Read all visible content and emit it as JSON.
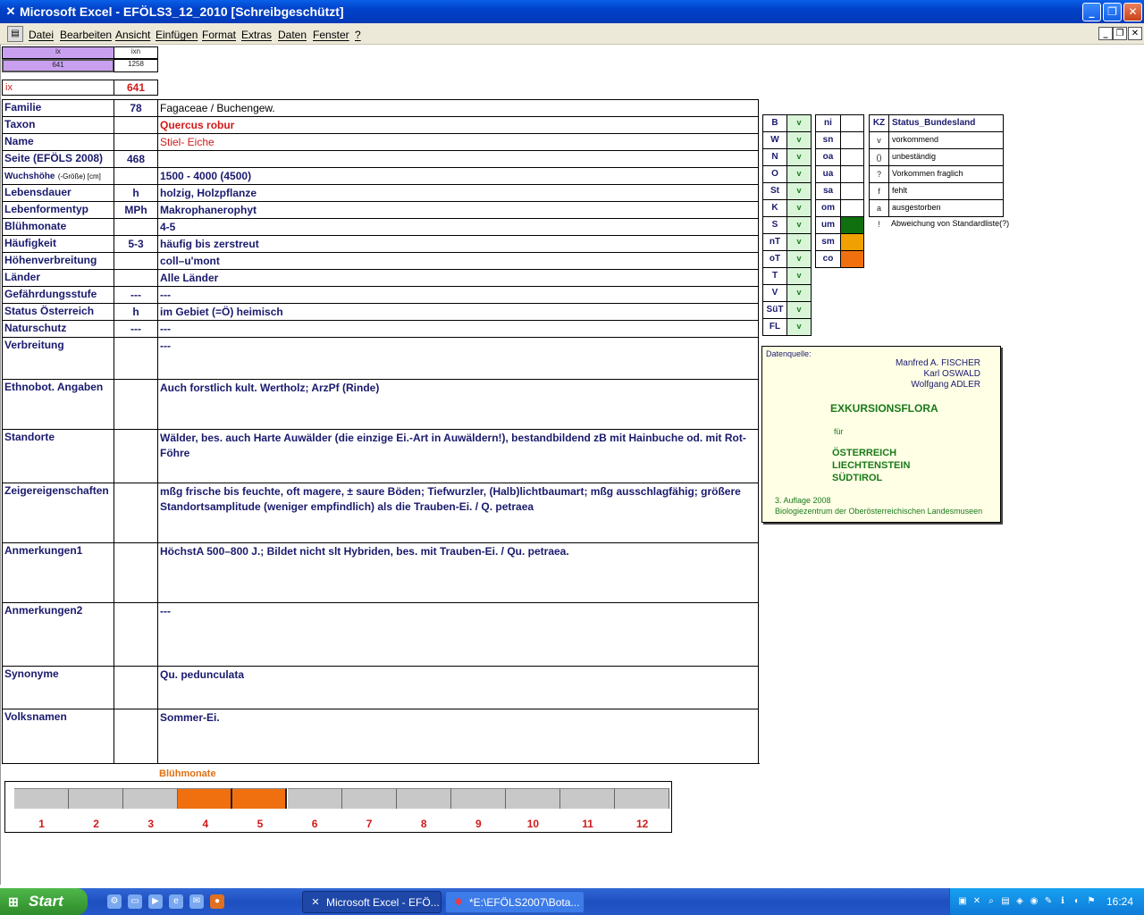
{
  "window": {
    "title": "Microsoft Excel - EFÖLS3_12_2010  [Schreibgeschützt]"
  },
  "menu": [
    "Datei",
    "Bearbeiten",
    "Ansicht",
    "Einfügen",
    "Format",
    "Extras",
    "Daten",
    "Fenster",
    "?"
  ],
  "top": {
    "h1": "ix",
    "h2": "ixn",
    "v1": "641",
    "v2": "1258",
    "ix_label": "ix",
    "ix_value": "641"
  },
  "rows": [
    {
      "label": "Familie",
      "num": "78",
      "value": "Fagaceae  /  Buchengew."
    },
    {
      "label": "Taxon",
      "num": "",
      "value": "Quercus robur"
    },
    {
      "label": "Name",
      "num": "",
      "value": "Stiel- Eiche"
    },
    {
      "label": "Seite (EFÖLS 2008)",
      "num": "468",
      "value": ""
    },
    {
      "label": "Wuchshöhe",
      "label_suffix": "(-Größe) [cm]",
      "num": "",
      "value": " 1500 - 4000 (4500)"
    },
    {
      "label": "Lebensdauer",
      "num": "h",
      "value": "holzig, Holzpflanze"
    },
    {
      "label": "Lebenformentyp",
      "num": "MPh",
      "value": "Makrophanerophyt"
    },
    {
      "label": "Blühmonate",
      "num": "",
      "value": " 4-5"
    },
    {
      "label": "Häufigkeit",
      "num": "5-3",
      "value": "häufig bis zerstreut"
    },
    {
      "label": "Höhenverbreitung",
      "num": "",
      "value": "coll–u'mont"
    },
    {
      "label": "Länder",
      "num": "",
      "value": "Alle Länder"
    },
    {
      "label": "Gefährdungsstufe",
      "num": "---",
      "value": "  ---"
    },
    {
      "label": "Status Österreich",
      "num": "h",
      "value": "im Gebiet (=Ö) heimisch"
    },
    {
      "label": "Naturschutz",
      "num": "---",
      "value": " ---"
    },
    {
      "label": "Verbreitung",
      "num": "",
      "value": " ---"
    },
    {
      "label": "Ethnobot. Angaben",
      "num": "",
      "value": "Auch forstlich kult. Wertholz; ArzPf (Rinde)"
    },
    {
      "label": "Standorte",
      "num": "",
      "value": "Wälder, bes. auch Harte Auwälder (die einzige Ei.-Art in Auwäldern!), bestandbildend zB mit Hainbuche od. mit Rot-Föhre"
    },
    {
      "label": "Zeigereigenschaften",
      "num": "",
      "value": "mßg frische bis feuchte, oft magere, ± saure Böden; Tiefwurzler, (Halb)lichtbaumart; mßg ausschlagfähig; größere Standortsamplitude (weniger empfindlich) als die Trauben-Ei. / Q. petraea"
    },
    {
      "label": "Anmerkungen1",
      "num": "",
      "value": "HöchstA 500–800 J.; Bildet nicht slt Hybriden, bes. mit Trauben-Ei. / Qu. petraea."
    },
    {
      "label": "Anmerkungen2",
      "num": "",
      "value": "---"
    },
    {
      "label": "Synonyme",
      "num": "",
      "value": "Qu. pedunculata"
    },
    {
      "label": "Volksnamen",
      "num": "",
      "value": "Sommer-Ei."
    }
  ],
  "bundesland": [
    {
      "k": "B",
      "v": "v"
    },
    {
      "k": "W",
      "v": "v"
    },
    {
      "k": "N",
      "v": "v"
    },
    {
      "k": "O",
      "v": "v"
    },
    {
      "k": "St",
      "v": "v"
    },
    {
      "k": "K",
      "v": "v"
    },
    {
      "k": "S",
      "v": "v"
    },
    {
      "k": "nT",
      "v": "v"
    },
    {
      "k": "oT",
      "v": "v"
    },
    {
      "k": "T",
      "v": "v"
    },
    {
      "k": "V",
      "v": "v"
    },
    {
      "k": "SüT",
      "v": "v"
    },
    {
      "k": "FL",
      "v": "v"
    }
  ],
  "altitude": [
    {
      "k": "ni",
      "color": ""
    },
    {
      "k": "sn",
      "color": ""
    },
    {
      "k": "oa",
      "color": ""
    },
    {
      "k": "ua",
      "color": ""
    },
    {
      "k": "sa",
      "color": ""
    },
    {
      "k": "om",
      "color": ""
    },
    {
      "k": "um",
      "color": "#107010"
    },
    {
      "k": "sm",
      "color": "#f0a000"
    },
    {
      "k": "co",
      "color": "#f07010"
    }
  ],
  "legend": {
    "kz": "KZ",
    "title": "Status_Bundesland",
    "items": [
      {
        "k": "v",
        "t": "vorkommend"
      },
      {
        "k": "()",
        "t": "unbeständig"
      },
      {
        "k": "?",
        "t": "Vorkommen fraglich"
      },
      {
        "k": "f",
        "t": "fehlt"
      },
      {
        "k": "a",
        "t": "ausgestorben"
      },
      {
        "k": "!",
        "t": "Abweichung von Standardliste(?)"
      }
    ]
  },
  "source": {
    "label": "Datenquelle:",
    "authors": [
      "Manfred A. FISCHER",
      "Karl OSWALD",
      "Wolfgang ADLER"
    ],
    "title": "EXKURSIONSFLORA",
    "fuer": "für",
    "countries": [
      "ÖSTERREICH",
      "LIECHTENSTEIN",
      "SÜDTIROL"
    ],
    "edition": "3. Auflage 2008",
    "publisher": "Biologiezentrum der Oberösterreichischen Landesmuseen"
  },
  "bloom": {
    "title": "Blühmonate",
    "months": [
      "1",
      "2",
      "3",
      "4",
      "5",
      "6",
      "7",
      "8",
      "9",
      "10",
      "11",
      "12"
    ],
    "active": [
      4,
      5
    ],
    "active_color": "#f07010",
    "inactive_color": "#c8c8c8"
  },
  "taskbar": {
    "start": "Start",
    "tasks": [
      "Microsoft Excel - EFÖ...",
      "*E:\\EFÖLS2007\\Bota..."
    ],
    "clock": "16:24"
  }
}
